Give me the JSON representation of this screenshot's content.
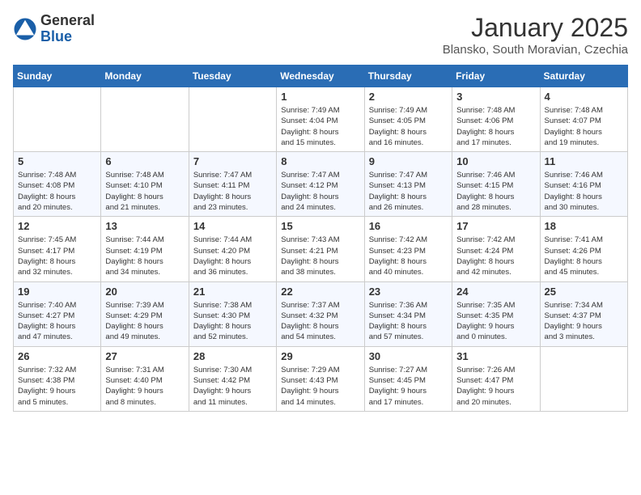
{
  "header": {
    "logo_general": "General",
    "logo_blue": "Blue",
    "month_title": "January 2025",
    "location": "Blansko, South Moravian, Czechia"
  },
  "weekdays": [
    "Sunday",
    "Monday",
    "Tuesday",
    "Wednesday",
    "Thursday",
    "Friday",
    "Saturday"
  ],
  "weeks": [
    [
      {
        "day": "",
        "info": ""
      },
      {
        "day": "",
        "info": ""
      },
      {
        "day": "",
        "info": ""
      },
      {
        "day": "1",
        "info": "Sunrise: 7:49 AM\nSunset: 4:04 PM\nDaylight: 8 hours\nand 15 minutes."
      },
      {
        "day": "2",
        "info": "Sunrise: 7:49 AM\nSunset: 4:05 PM\nDaylight: 8 hours\nand 16 minutes."
      },
      {
        "day": "3",
        "info": "Sunrise: 7:48 AM\nSunset: 4:06 PM\nDaylight: 8 hours\nand 17 minutes."
      },
      {
        "day": "4",
        "info": "Sunrise: 7:48 AM\nSunset: 4:07 PM\nDaylight: 8 hours\nand 19 minutes."
      }
    ],
    [
      {
        "day": "5",
        "info": "Sunrise: 7:48 AM\nSunset: 4:08 PM\nDaylight: 8 hours\nand 20 minutes."
      },
      {
        "day": "6",
        "info": "Sunrise: 7:48 AM\nSunset: 4:10 PM\nDaylight: 8 hours\nand 21 minutes."
      },
      {
        "day": "7",
        "info": "Sunrise: 7:47 AM\nSunset: 4:11 PM\nDaylight: 8 hours\nand 23 minutes."
      },
      {
        "day": "8",
        "info": "Sunrise: 7:47 AM\nSunset: 4:12 PM\nDaylight: 8 hours\nand 24 minutes."
      },
      {
        "day": "9",
        "info": "Sunrise: 7:47 AM\nSunset: 4:13 PM\nDaylight: 8 hours\nand 26 minutes."
      },
      {
        "day": "10",
        "info": "Sunrise: 7:46 AM\nSunset: 4:15 PM\nDaylight: 8 hours\nand 28 minutes."
      },
      {
        "day": "11",
        "info": "Sunrise: 7:46 AM\nSunset: 4:16 PM\nDaylight: 8 hours\nand 30 minutes."
      }
    ],
    [
      {
        "day": "12",
        "info": "Sunrise: 7:45 AM\nSunset: 4:17 PM\nDaylight: 8 hours\nand 32 minutes."
      },
      {
        "day": "13",
        "info": "Sunrise: 7:44 AM\nSunset: 4:19 PM\nDaylight: 8 hours\nand 34 minutes."
      },
      {
        "day": "14",
        "info": "Sunrise: 7:44 AM\nSunset: 4:20 PM\nDaylight: 8 hours\nand 36 minutes."
      },
      {
        "day": "15",
        "info": "Sunrise: 7:43 AM\nSunset: 4:21 PM\nDaylight: 8 hours\nand 38 minutes."
      },
      {
        "day": "16",
        "info": "Sunrise: 7:42 AM\nSunset: 4:23 PM\nDaylight: 8 hours\nand 40 minutes."
      },
      {
        "day": "17",
        "info": "Sunrise: 7:42 AM\nSunset: 4:24 PM\nDaylight: 8 hours\nand 42 minutes."
      },
      {
        "day": "18",
        "info": "Sunrise: 7:41 AM\nSunset: 4:26 PM\nDaylight: 8 hours\nand 45 minutes."
      }
    ],
    [
      {
        "day": "19",
        "info": "Sunrise: 7:40 AM\nSunset: 4:27 PM\nDaylight: 8 hours\nand 47 minutes."
      },
      {
        "day": "20",
        "info": "Sunrise: 7:39 AM\nSunset: 4:29 PM\nDaylight: 8 hours\nand 49 minutes."
      },
      {
        "day": "21",
        "info": "Sunrise: 7:38 AM\nSunset: 4:30 PM\nDaylight: 8 hours\nand 52 minutes."
      },
      {
        "day": "22",
        "info": "Sunrise: 7:37 AM\nSunset: 4:32 PM\nDaylight: 8 hours\nand 54 minutes."
      },
      {
        "day": "23",
        "info": "Sunrise: 7:36 AM\nSunset: 4:34 PM\nDaylight: 8 hours\nand 57 minutes."
      },
      {
        "day": "24",
        "info": "Sunrise: 7:35 AM\nSunset: 4:35 PM\nDaylight: 9 hours\nand 0 minutes."
      },
      {
        "day": "25",
        "info": "Sunrise: 7:34 AM\nSunset: 4:37 PM\nDaylight: 9 hours\nand 3 minutes."
      }
    ],
    [
      {
        "day": "26",
        "info": "Sunrise: 7:32 AM\nSunset: 4:38 PM\nDaylight: 9 hours\nand 5 minutes."
      },
      {
        "day": "27",
        "info": "Sunrise: 7:31 AM\nSunset: 4:40 PM\nDaylight: 9 hours\nand 8 minutes."
      },
      {
        "day": "28",
        "info": "Sunrise: 7:30 AM\nSunset: 4:42 PM\nDaylight: 9 hours\nand 11 minutes."
      },
      {
        "day": "29",
        "info": "Sunrise: 7:29 AM\nSunset: 4:43 PM\nDaylight: 9 hours\nand 14 minutes."
      },
      {
        "day": "30",
        "info": "Sunrise: 7:27 AM\nSunset: 4:45 PM\nDaylight: 9 hours\nand 17 minutes."
      },
      {
        "day": "31",
        "info": "Sunrise: 7:26 AM\nSunset: 4:47 PM\nDaylight: 9 hours\nand 20 minutes."
      },
      {
        "day": "",
        "info": ""
      }
    ]
  ]
}
